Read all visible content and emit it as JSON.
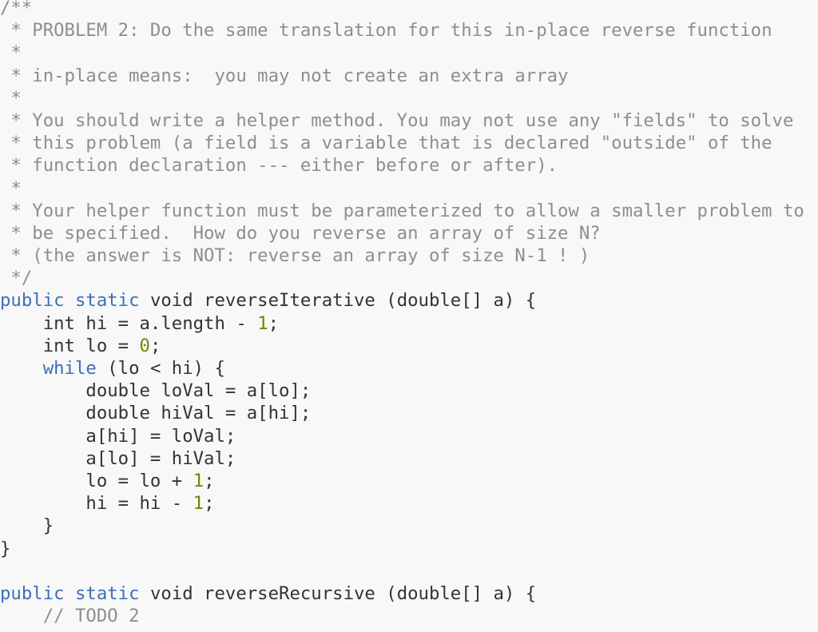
{
  "editor": {
    "colors": {
      "background": "#f8f8f8",
      "text": "#333333",
      "comment": "#8e8e8e",
      "keyword": "#3d6fb6",
      "number": "#6b8a00"
    },
    "lines": [
      [
        {
          "t": "cm",
          "v": "/**"
        }
      ],
      [
        {
          "t": "cm",
          "v": " * PROBLEM 2: Do the same translation for this in-place reverse function"
        }
      ],
      [
        {
          "t": "cm",
          "v": " *"
        }
      ],
      [
        {
          "t": "cm",
          "v": " * in-place means:  you may not create an extra array"
        }
      ],
      [
        {
          "t": "cm",
          "v": " *"
        }
      ],
      [
        {
          "t": "cm",
          "v": " * You should write a helper method. You may not use any \"fields\" to solve"
        }
      ],
      [
        {
          "t": "cm",
          "v": " * this problem (a field is a variable that is declared \"outside\" of the"
        }
      ],
      [
        {
          "t": "cm",
          "v": " * function declaration --- either before or after)."
        }
      ],
      [
        {
          "t": "cm",
          "v": " *"
        }
      ],
      [
        {
          "t": "cm",
          "v": " * Your helper function must be parameterized to allow a smaller problem to"
        }
      ],
      [
        {
          "t": "cm",
          "v": " * be specified.  How do you reverse an array of size N?"
        }
      ],
      [
        {
          "t": "cm",
          "v": " * (the answer is NOT: reverse an array of size N-1 ! )"
        }
      ],
      [
        {
          "t": "cm",
          "v": " */"
        }
      ],
      [
        {
          "t": "kw",
          "v": "public static"
        },
        {
          "t": "tx",
          "v": " void reverseIterative (double[] a) {"
        }
      ],
      [
        {
          "t": "tx",
          "v": "    int hi = a.length - "
        },
        {
          "t": "num",
          "v": "1"
        },
        {
          "t": "tx",
          "v": ";"
        }
      ],
      [
        {
          "t": "tx",
          "v": "    int lo = "
        },
        {
          "t": "num",
          "v": "0"
        },
        {
          "t": "tx",
          "v": ";"
        }
      ],
      [
        {
          "t": "tx",
          "v": "    "
        },
        {
          "t": "kw",
          "v": "while"
        },
        {
          "t": "tx",
          "v": " (lo < hi) {"
        }
      ],
      [
        {
          "t": "tx",
          "v": "        double loVal = a[lo];"
        }
      ],
      [
        {
          "t": "tx",
          "v": "        double hiVal = a[hi];"
        }
      ],
      [
        {
          "t": "tx",
          "v": "        a[hi] = loVal;"
        }
      ],
      [
        {
          "t": "tx",
          "v": "        a[lo] = hiVal;"
        }
      ],
      [
        {
          "t": "tx",
          "v": "        lo = lo + "
        },
        {
          "t": "num",
          "v": "1"
        },
        {
          "t": "tx",
          "v": ";"
        }
      ],
      [
        {
          "t": "tx",
          "v": "        hi = hi - "
        },
        {
          "t": "num",
          "v": "1"
        },
        {
          "t": "tx",
          "v": ";"
        }
      ],
      [
        {
          "t": "tx",
          "v": "    }"
        }
      ],
      [
        {
          "t": "tx",
          "v": "}"
        }
      ],
      [
        {
          "t": "tx",
          "v": ""
        }
      ],
      [
        {
          "t": "kw",
          "v": "public static"
        },
        {
          "t": "tx",
          "v": " void reverseRecursive (double[] a) {"
        }
      ],
      [
        {
          "t": "cm",
          "v": "    // TODO 2"
        }
      ]
    ]
  }
}
